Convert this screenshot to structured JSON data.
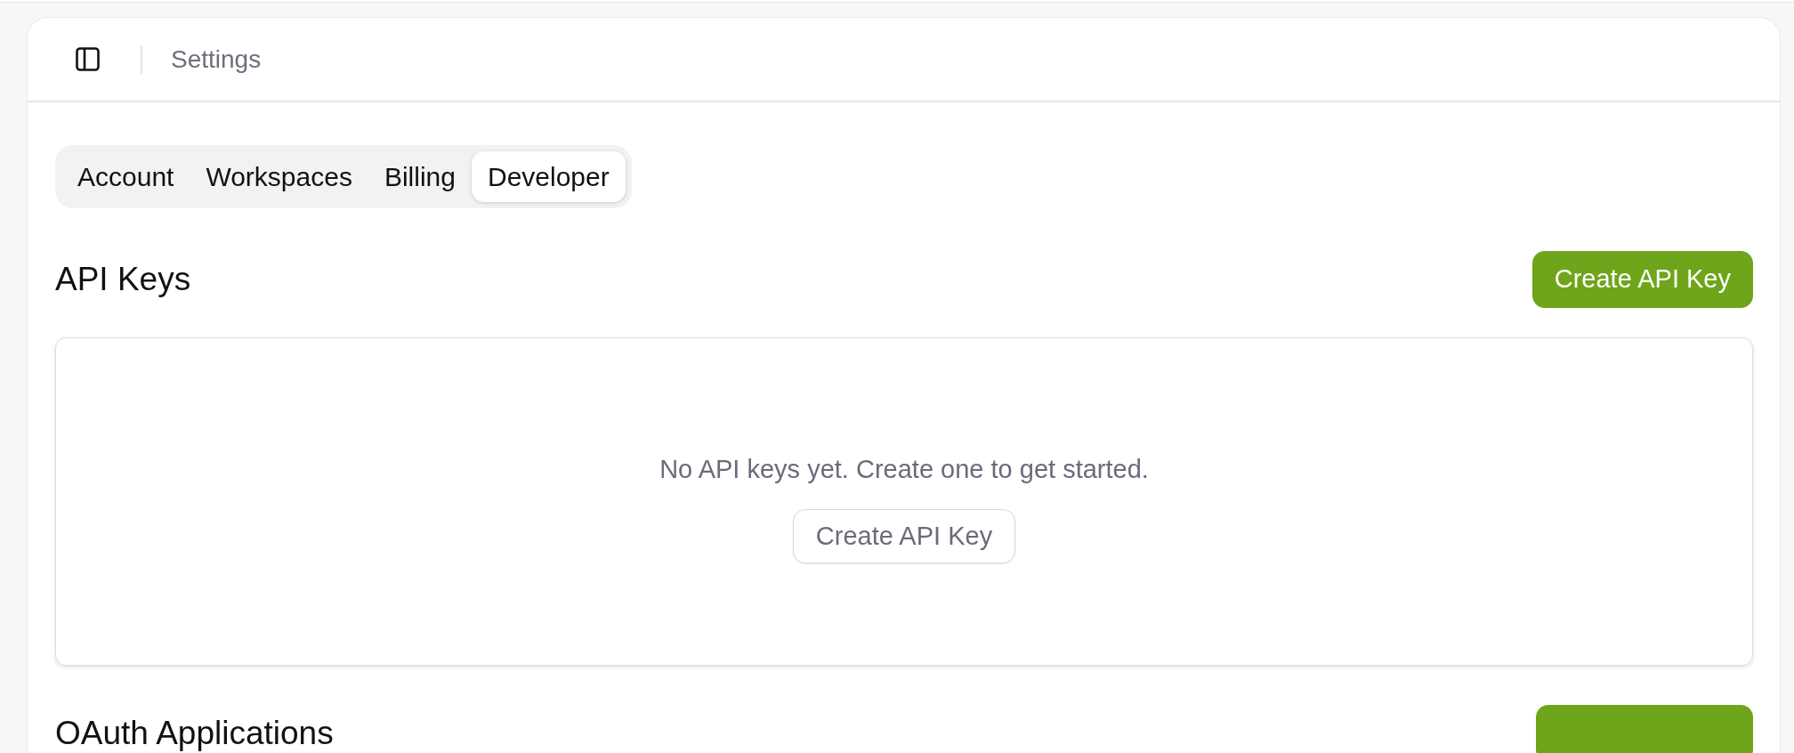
{
  "header": {
    "title": "Settings"
  },
  "tabs": [
    {
      "label": "Account",
      "selected": false
    },
    {
      "label": "Workspaces",
      "selected": false
    },
    {
      "label": "Billing",
      "selected": false
    },
    {
      "label": "Developer",
      "selected": true
    }
  ],
  "sections": [
    {
      "title": "API Keys",
      "action": {
        "kind": "primary",
        "label": "Create API Key"
      },
      "empty_state": {
        "message": "No API keys yet. Create one to get started.",
        "action": {
          "kind": "outline",
          "label": "Create API Key"
        }
      }
    },
    {
      "title": "OAuth Applications",
      "action": {
        "kind": "primary"
      }
    }
  ]
}
